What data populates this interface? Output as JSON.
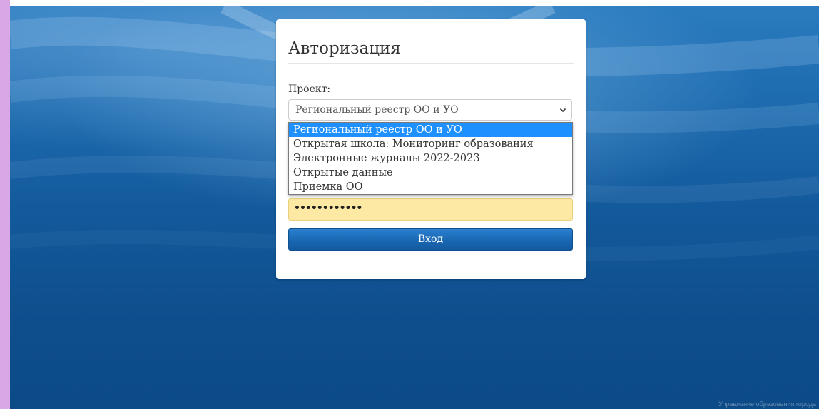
{
  "auth": {
    "title": "Авторизация",
    "project_label": "Проект:",
    "project_selected": "Региональный реестр ОО и УО",
    "project_options": [
      "Региональный реестр ОО и УО",
      "Открытая школа: Мониторинг образования",
      "Электронные журналы 2022-2023",
      "Открытые данные",
      "Приемка ОО"
    ],
    "password_value": "••••••••••••",
    "login_button": "Вход"
  },
  "footer": {
    "text": "Управление образования города"
  },
  "colors": {
    "accent": "#1a68b3",
    "selected_option": "#1e90ff",
    "autofill": "#fde9a3",
    "background": "#135a9c"
  }
}
